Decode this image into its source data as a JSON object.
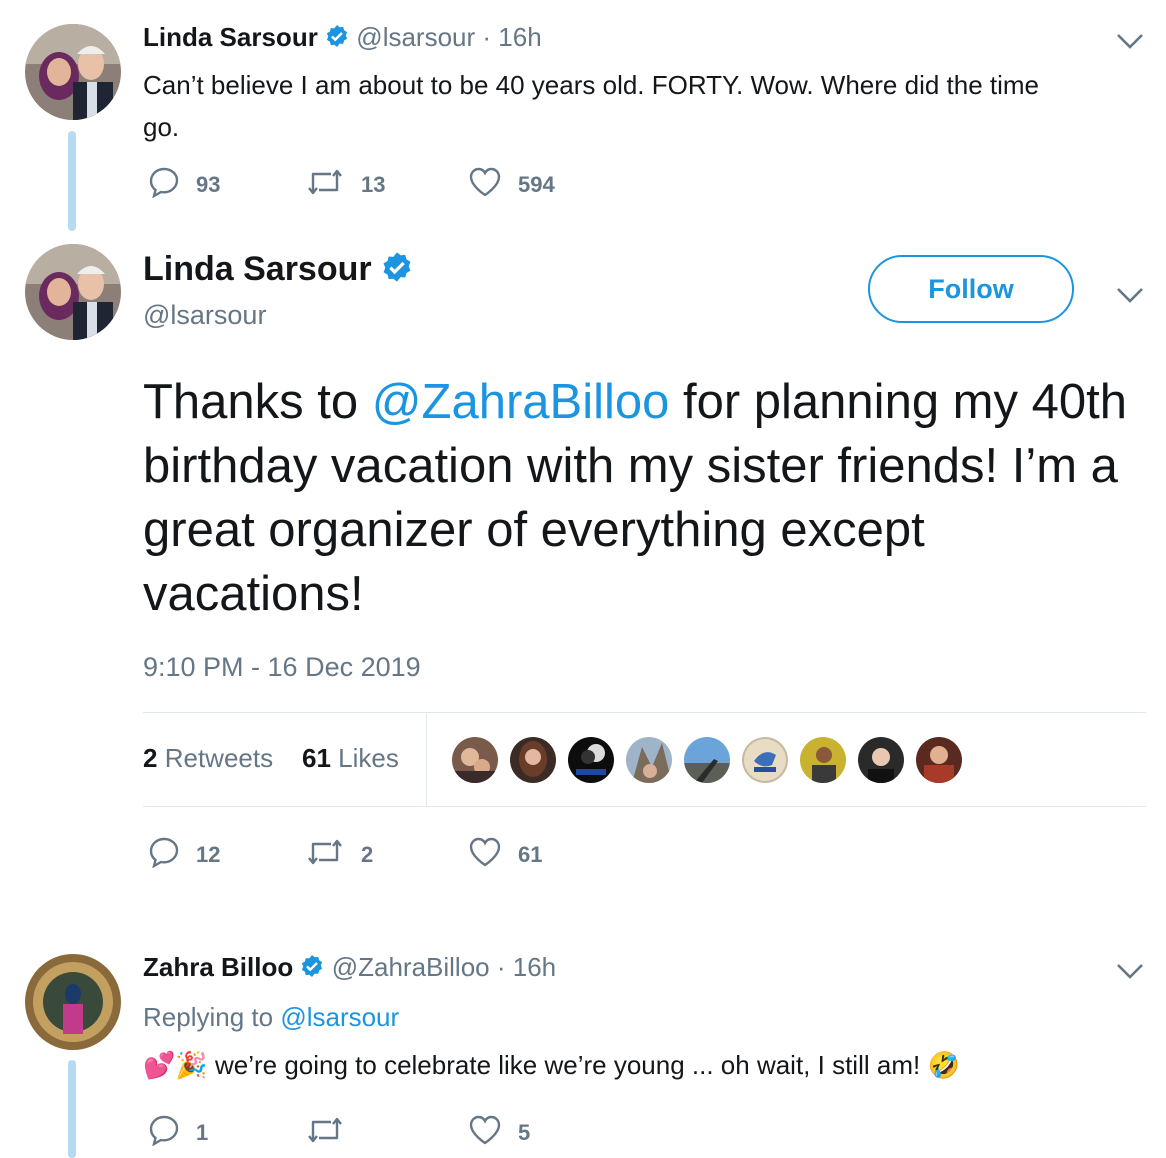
{
  "tweet1": {
    "name": "Linda Sarsour",
    "handle": "@lsarsour",
    "time": "· 16h",
    "text": "Can’t believe I am about to be 40 years old. FORTY. Wow. Where did the time go.",
    "text_line1": "Can’t believe I am about to be 40 years old. FORTY. Wow. Where did the time",
    "text_line2": "go.",
    "replies": "93",
    "retweets": "13",
    "likes": "594"
  },
  "main_tweet": {
    "name": "Linda Sarsour",
    "handle": "@lsarsour",
    "follow_label": "Follow",
    "text_before": "Thanks to ",
    "mention": "@ZahraBilloo",
    "text_after": " for planning my 40th birthday vacation with my sister friends! I’m a great organizer of everything except vacations!",
    "timestamp": "9:10 PM - 16 Dec 2019",
    "retweet_count": "2",
    "retweet_label": "Retweets",
    "like_count": "61",
    "like_label": "Likes",
    "replies": "12",
    "retweets": "2",
    "likes": "61"
  },
  "reply_tweet": {
    "name": "Zahra Billoo",
    "handle": "@ZahraBilloo",
    "time": "· 16h",
    "replying_prefix": "Replying to ",
    "replying_to": "@lsarsour",
    "emoji_prefix": "💕🎉",
    "text": " we’re going to celebrate like we’re young ... oh wait, I still am!",
    "emoji_suffix": "🤣",
    "replies": "1",
    "retweets": "",
    "likes": "5"
  },
  "colors": {
    "link": "#1b95e0",
    "muted": "#657786",
    "thread_line": "#b6daf2",
    "text": "#14171a"
  },
  "icons": [
    "verified-badge-icon",
    "chevron-down-icon",
    "reply-icon",
    "retweet-icon",
    "heart-icon"
  ]
}
